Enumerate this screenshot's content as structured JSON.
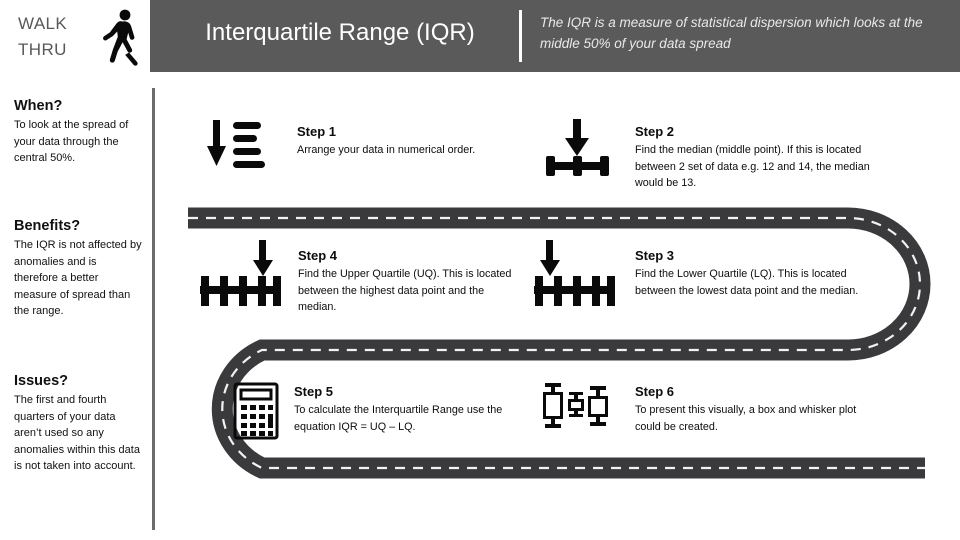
{
  "header": {
    "walk_line1": "WALK",
    "walk_line2": "THRU",
    "walker_icon": "walking-person-icon",
    "title": "Interquartile Range (IQR)",
    "subtitle": "The IQR is a measure of statistical dispersion which looks at the middle 50% of your data spread"
  },
  "sidebar": {
    "sections": [
      {
        "heading": "When?",
        "body": "To look at the spread of your data through the central 50%."
      },
      {
        "heading": "Benefits?",
        "body": "The IQR is not affected by anomalies and is therefore a better measure of spread than the range."
      },
      {
        "heading": "Issues?",
        "body": "The first and fourth quarters of your data aren’t used so any anomalies within this data is not taken into account."
      }
    ]
  },
  "steps": [
    {
      "id": "step-1",
      "title": "Step 1",
      "description": "Arrange your data in numerical order.",
      "icon": "sort-descending-arrow-icon"
    },
    {
      "id": "step-2",
      "title": "Step 2",
      "description": "Find the median (middle point). If this is located between 2 set of data e.g. 12 and 14, the median would be 13.",
      "icon": "arrow-to-median-axis-icon"
    },
    {
      "id": "step-3",
      "title": "Step 3",
      "description": "Find the Lower Quartile (LQ). This is located between the lowest data point and the median.",
      "icon": "arrow-to-lower-quartile-axis-icon"
    },
    {
      "id": "step-4",
      "title": "Step 4",
      "description": "Find the Upper Quartile (UQ). This is located between the highest data point and the median.",
      "icon": "arrow-to-upper-quartile-axis-icon"
    },
    {
      "id": "step-5",
      "title": "Step 5",
      "description": "To calculate the Interquartile Range use the equation IQR = UQ – LQ.",
      "icon": "calculator-icon"
    },
    {
      "id": "step-6",
      "title": "Step 6",
      "description": "To present this visually, a box and whisker plot could be created.",
      "icon": "box-and-whisker-plot-icon"
    }
  ],
  "road": {
    "name": "winding-road-path",
    "asphalt_color": "#3a3a3c",
    "lane_marking_color": "#f2f2f2"
  },
  "colors": {
    "header_bar": "#5a5a5a",
    "header_text": "#ffffff",
    "divider": "#6b6b6b",
    "body_text": "#111111",
    "background": "#ffffff"
  }
}
